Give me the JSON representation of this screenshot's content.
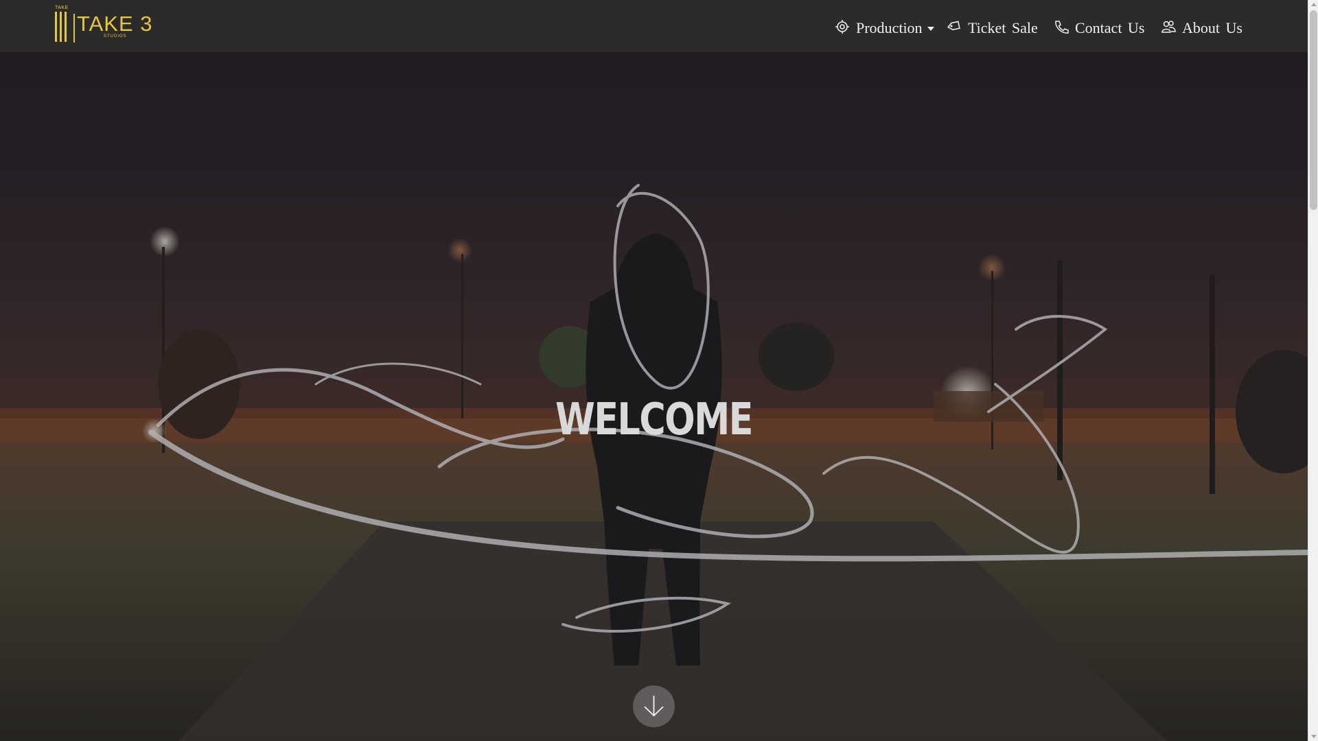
{
  "colors": {
    "brand_gold": "#e6c63a",
    "navbar_bg": "#2b2b2b",
    "nav_text": "#f1f1f1",
    "welcome_text": "#d9d9d9"
  },
  "logo": {
    "small_text": "TAKE",
    "word": "TAKE 3",
    "sub": "STUDIOS"
  },
  "nav": {
    "items": [
      {
        "label": "Production",
        "icon": "target-icon",
        "has_dropdown": true
      },
      {
        "label": "Ticket Sale",
        "icon": "ticket-icon",
        "has_dropdown": false
      },
      {
        "label": "Contact Us",
        "icon": "phone-icon",
        "has_dropdown": false
      },
      {
        "label": "About Us",
        "icon": "users-icon",
        "has_dropdown": false
      }
    ]
  },
  "hero": {
    "headline": "WELCOME",
    "scroll_icon": "arrow-down-icon"
  }
}
